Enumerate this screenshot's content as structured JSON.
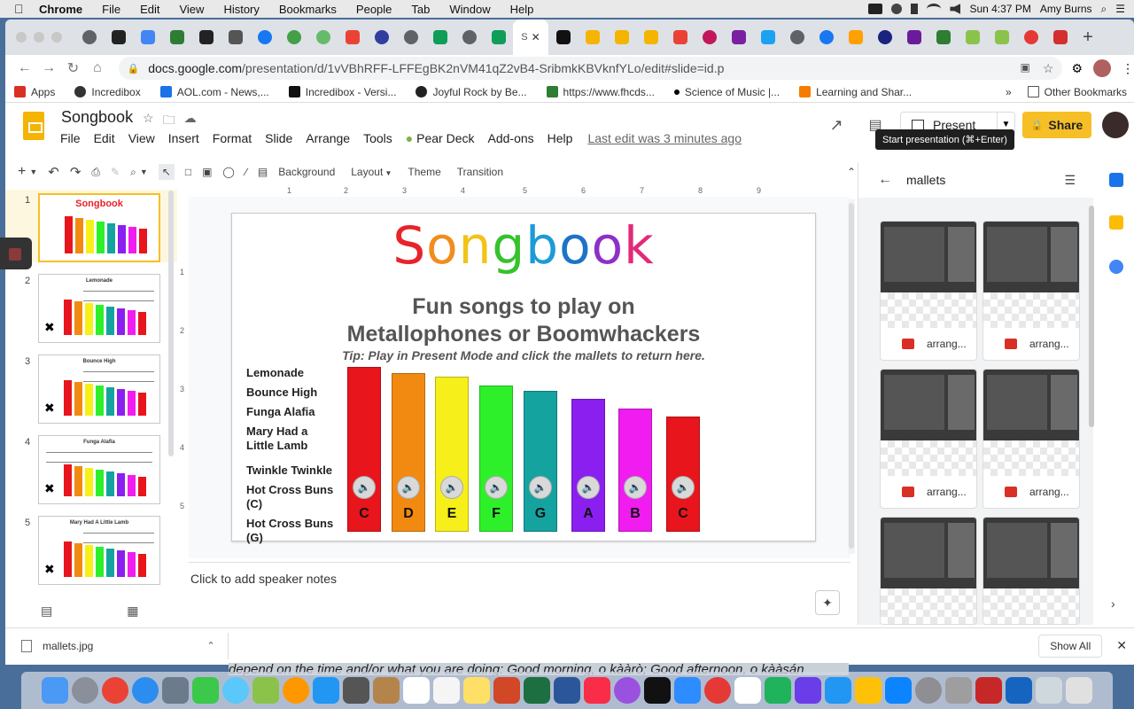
{
  "mac_menubar": {
    "app": "Chrome",
    "items": [
      "File",
      "Edit",
      "View",
      "History",
      "Bookmarks",
      "People",
      "Tab",
      "Window",
      "Help"
    ],
    "clock": "Sun 4:37 PM",
    "user": "Amy Burns"
  },
  "browser": {
    "active_tab_label": "S",
    "url_prefix": "docs.google.com",
    "url_rest": "/presentation/d/1vVBhRFF-LFFEgBK2nVM41qZ2vB4-SribmkKBVknfYLo/edit#slide=id.p",
    "bookmarks": [
      "Apps",
      "Incredibox",
      "AOL.com - News,...",
      "Incredibox - Versi...",
      "Joyful Rock by Be...",
      "https://www.fhcds...",
      "Science of Music |...",
      "Learning and Shar..."
    ],
    "other_bookmarks": "Other Bookmarks"
  },
  "slides": {
    "doc_title": "Songbook",
    "menu": [
      "File",
      "Edit",
      "View",
      "Insert",
      "Format",
      "Slide",
      "Arrange",
      "Tools",
      "Pear Deck",
      "Add-ons",
      "Help"
    ],
    "last_edit": "Last edit was 3 minutes ago",
    "present_label": "Present",
    "share_label": "Share",
    "tooltip": "Start presentation (⌘+Enter)",
    "toolbar": {
      "background": "Background",
      "layout": "Layout",
      "theme": "Theme",
      "transition": "Transition"
    },
    "ruler_marks": [
      "1",
      "2",
      "3",
      "4",
      "5",
      "6",
      "7",
      "8",
      "9"
    ],
    "vruler_marks": [
      "1",
      "2",
      "3",
      "4",
      "5"
    ],
    "speaker_notes_placeholder": "Click to add speaker notes",
    "thumbnails": [
      {
        "num": "1",
        "title": "Songbook"
      },
      {
        "num": "2",
        "title": "Lemonade"
      },
      {
        "num": "3",
        "title": "Bounce High"
      },
      {
        "num": "4",
        "title": "Funga Alafia"
      },
      {
        "num": "5",
        "title": "Mary Had A Little Lamb"
      }
    ]
  },
  "slide": {
    "title_letters": [
      "S",
      "o",
      "n",
      "g",
      "b",
      "o",
      "o",
      "k"
    ],
    "title_colors": [
      "#e8232a",
      "#f18d1e",
      "#f2c318",
      "#36c22b",
      "#1c9bd7",
      "#1c73c8",
      "#8e2fc7",
      "#e32a78"
    ],
    "subtitle_line1": "Fun songs to play on",
    "subtitle_line2": "Metallophones or Boomwhackers",
    "tip": "Tip: Play in Present Mode and click the mallets to return here.",
    "songs": [
      "Lemonade",
      "Bounce High",
      "Funga Alafia",
      "Mary Had a Little Lamb",
      "Twinkle Twinkle",
      "Hot Cross Buns (C)",
      "Hot Cross Buns (G)"
    ],
    "bars": [
      {
        "note": "C",
        "color": "#e8151c"
      },
      {
        "note": "D",
        "color": "#f28a12"
      },
      {
        "note": "E",
        "color": "#f6ef1a"
      },
      {
        "note": "F",
        "color": "#2ef02a"
      },
      {
        "note": "G",
        "color": "#15a3a0"
      },
      {
        "note": "A",
        "color": "#8b1ff0"
      },
      {
        "note": "B",
        "color": "#f01cf0"
      },
      {
        "note": "C",
        "color": "#e8151c"
      }
    ]
  },
  "search_panel": {
    "query": "mallets",
    "results": [
      "arrang...",
      "arrang...",
      "arrang...",
      "arrang..."
    ]
  },
  "download": {
    "file": "mallets.jpg",
    "show_all": "Show All"
  },
  "background_caption": "depend on the time and/or what you are doing: Good morning, o kààrò; Good afternoon, o kààsán"
}
